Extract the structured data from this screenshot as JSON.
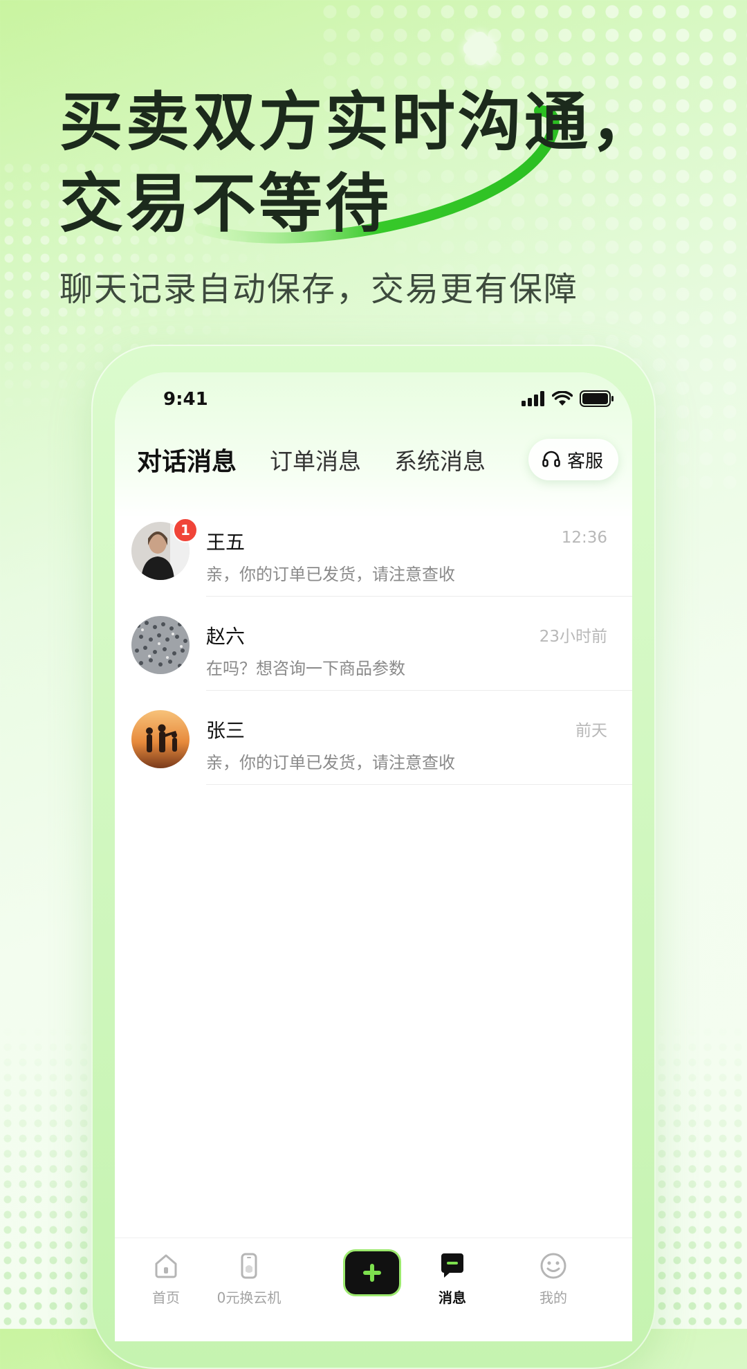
{
  "hero": {
    "headline_line1": "买卖双方实时沟通，",
    "headline_line2": "交易不等待",
    "subtitle": "聊天记录自动保存，交易更有保障"
  },
  "status_bar": {
    "time": "9:41"
  },
  "tabs": [
    {
      "label": "对话消息",
      "active": true
    },
    {
      "label": "订单消息",
      "active": false
    },
    {
      "label": "系统消息",
      "active": false
    }
  ],
  "service": {
    "label": "客服",
    "icon": "headset-icon"
  },
  "messages": [
    {
      "name": "王五",
      "time": "12:36",
      "preview": "亲，你的订单已发货，请注意查收",
      "unread": "1",
      "avatar": "avatar-woman-photo"
    },
    {
      "name": "赵六",
      "time": "23小时前",
      "preview": "在吗？想咨询一下商品参数",
      "unread": null,
      "avatar": "avatar-crowd-photo"
    },
    {
      "name": "张三",
      "time": "前天",
      "preview": "亲，你的订单已发货，请注意查收",
      "unread": null,
      "avatar": "avatar-sunset-photo"
    }
  ],
  "tabbar": [
    {
      "label": "首页",
      "icon": "home-icon",
      "active": false
    },
    {
      "label": "0元换云机",
      "icon": "phone-icon",
      "active": false
    },
    {
      "label": "",
      "icon": "plus-icon",
      "active": false
    },
    {
      "label": "消息",
      "icon": "chat-icon",
      "active": true
    },
    {
      "label": "我的",
      "icon": "smiley-icon",
      "active": false
    }
  ],
  "colors": {
    "accent_green": "#3ecf2f",
    "badge_red": "#f04438",
    "dark": "#111111"
  }
}
